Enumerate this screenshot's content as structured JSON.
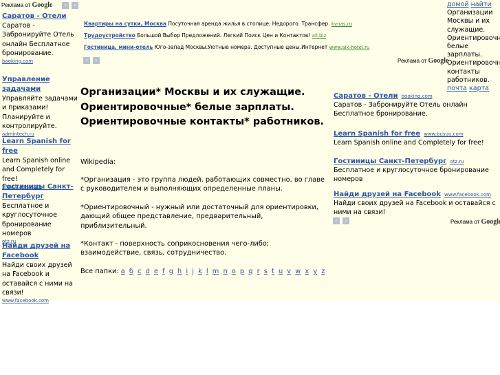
{
  "ads_label": "Реклама от",
  "google": "Google",
  "nav": {
    "prev": "‹",
    "next": "›"
  },
  "left_ads": [
    {
      "title": "Саратов - Отели",
      "text": "Саратов - Забронируйте Отель онлайн Бесплатное бронирование.",
      "url": "booking.com"
    },
    {
      "title": "Управление задачами",
      "text": "Управляйте задачами и приказами! Планируйте и контролируйте.",
      "url": "admintech.ru"
    },
    {
      "title": "Learn Spanish for free",
      "text": "Learn Spanish online and Completely for free!",
      "url": "www.busuu.com"
    },
    {
      "title": "Гостиницы Санкт-Петербург",
      "text": "Бесплатное и круглосуточное бронирование номеров",
      "url": "otz.ru"
    },
    {
      "title": "Найди друзей на Facebook",
      "text": "Найди своих друзей на Facebook и оставайся с ними на связи!",
      "url": "www.facebook.com"
    }
  ],
  "top_ads": [
    {
      "title": "Квартиры на сутки, Москва",
      "text": "Посуточная аренда жилья в столице. Недорого. Трансфер.",
      "url": "kvnas.ru"
    },
    {
      "title": "Трудоустройство",
      "text": "Большой Выбор Предложений. Легкий Поиск Цен и Контактов!",
      "url": "all.biz"
    },
    {
      "title": "Гостиница, мини-отель",
      "text": "Юго-запад Москвы.Уютные номера. Доступные цены.Интернет",
      "url": "www.aik-hotel.ru"
    }
  ],
  "right_menu": {
    "home": "домой",
    "find": "найти",
    "desc": "Организации Москвы и их служащие. Ориентировочные белые зарплаты. Ориентировочные контакты работников.",
    "mail": "почта",
    "map": "карта"
  },
  "main": {
    "heading": "Организации* Москвы и их служащие. Ориентировочные* белые зарплаты. Ориентировочные контакты* работников.",
    "wiki": "Wikipedia:",
    "def1": "*Организация - это группа людей, работающих совместно, во главе с руководителем и выполняющих определенные планы.",
    "def2": "*Ориентировочный - нужный или достаточный для ориентировки, дающий общее представление, предварительный, приблизительный.",
    "def3": "*Контакт - поверхность соприкосновения чего-либо; взаимодействие, связь, сотрудничество.",
    "folders_label": "Все папки:",
    "letters": [
      "а",
      "б",
      "с",
      "d",
      "е",
      "f",
      "g",
      "h",
      "i",
      "j",
      "k",
      "l",
      "m",
      "n",
      "o",
      "p",
      "q",
      "r",
      "s",
      "t",
      "u",
      "v",
      "w",
      "x",
      "y",
      "z"
    ]
  },
  "right_ads": [
    {
      "title": "Саратов - Отели",
      "url": "booking.com",
      "text": "Саратов - Забронируйте Отель онлайн Бесплатное бронирование."
    },
    {
      "title": "Learn Spanish for free",
      "url": "www.busuu.com",
      "text": "Learn Spanish online and Completely for free!"
    },
    {
      "title": "Гостиницы Санкт-Петербург",
      "url": "otz.ru",
      "text": "Бесплатное и круглосуточное бронирование номеров"
    },
    {
      "title": "Найди друзей на Facebook",
      "url": "www.facebook.com",
      "text": "Найди своих друзей на Facebook и оставайся с ними на связи!"
    }
  ]
}
